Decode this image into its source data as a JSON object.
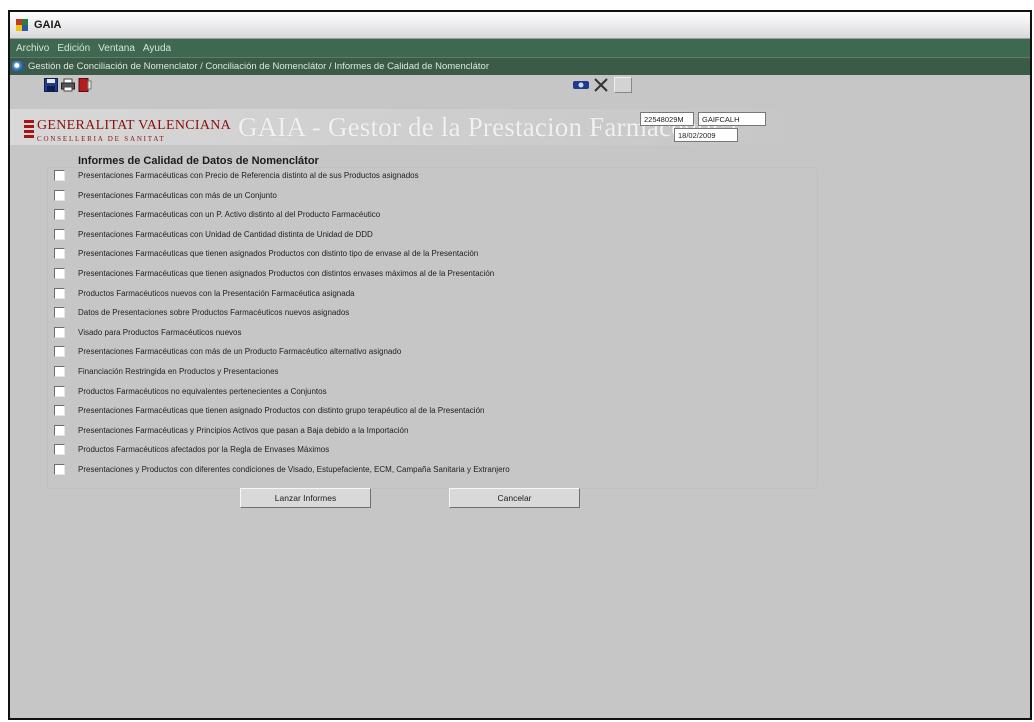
{
  "window": {
    "title": "GAIA"
  },
  "menu": [
    {
      "label": "Archivo"
    },
    {
      "label": "Edición"
    },
    {
      "label": "Ventana"
    },
    {
      "label": "Ayuda"
    }
  ],
  "breadcrumb": "Gestión de Conciliación de Nomenclator / Conciliación de Nomenclátor / Informes de Calidad de Nomenclátor",
  "header": {
    "logo_name": "GENERALITAT VALENCIANA",
    "logo_sub": "CONSELLERIA DE SANITAT",
    "app_title": "GAIA - Gestor de la Prestacion Farmaceutica",
    "user_id": "22548029M",
    "user_code": "GAIFCALH",
    "date": "18/02/2009"
  },
  "panel": {
    "title": "Informes de Calidad de Datos de Nomenclátor",
    "items": [
      {
        "label": "Presentaciones Farmacéuticas con Precio de Referencia distinto al de sus Productos asignados"
      },
      {
        "label": "Presentaciones Farmacéuticas con más de un Conjunto"
      },
      {
        "label": "Presentaciones Farmacéuticas con un P. Activo distinto al del Producto Farmacéutico"
      },
      {
        "label": "Presentaciones Farmacéuticas con Unidad de Cantidad distinta de Unidad de DDD"
      },
      {
        "label": "Presentaciones Farmacéuticas que tienen asignados Productos con distinto tipo de envase al de la Presentación"
      },
      {
        "label": "Presentaciones Farmacéuticas que tienen asignados Productos con distintos envases máximos al de la Presentación"
      },
      {
        "label": "Productos Farmacéuticos nuevos con la Presentación Farmacéutica asignada"
      },
      {
        "label": "Datos de Presentaciones sobre Productos Farmacéuticos nuevos asignados"
      },
      {
        "label": "Visado para Productos Farmacéuticos nuevos"
      },
      {
        "label": "Presentaciones Farmacéuticas con más de un Producto Farmacéutico alternativo asignado"
      },
      {
        "label": "Financiación Restringida en Productos y Presentaciones"
      },
      {
        "label": "Productos Farmacéuticos no equivalentes pertenecientes a Conjuntos"
      },
      {
        "label": "Presentaciones Farmacéuticas que tienen asignado Productos con distinto grupo terapéutico al de la Presentación"
      },
      {
        "label": "Presentaciones Farmacéuticas y Principios Activos que pasan a Baja debido a la Importación"
      },
      {
        "label": "Productos Farmacéuticos afectados por la Regla de Envases Máximos"
      },
      {
        "label": "Presentaciones y Productos con diferentes condiciones de Visado, Estupefaciente, ECM, Campaña Sanitaria y Extranjero"
      }
    ]
  },
  "buttons": {
    "launch": "Lanzar Informes",
    "cancel": "Cancelar"
  },
  "colors": {
    "menubar": "#3e6850",
    "pathbar": "#3b5b48",
    "logo": "#8a1010",
    "background": "#c6c6c6"
  }
}
